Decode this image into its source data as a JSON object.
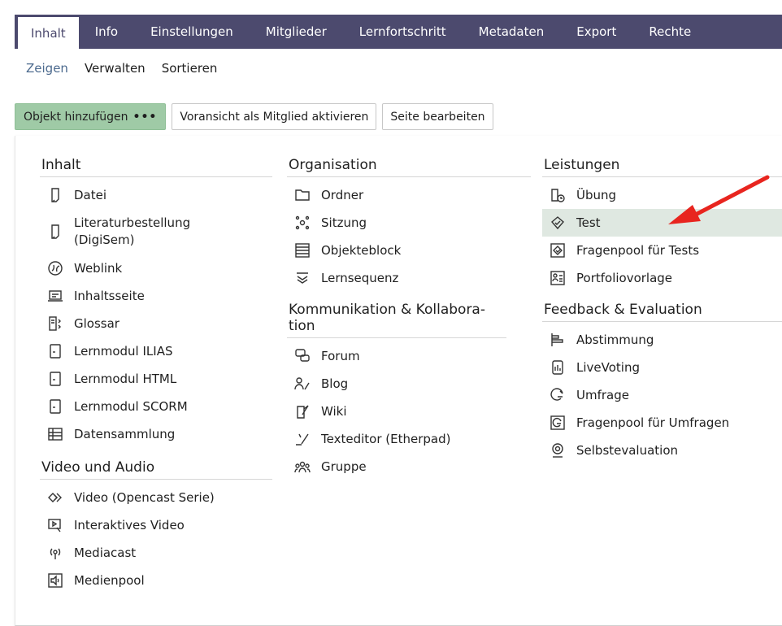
{
  "tabs": [
    {
      "label": "Inhalt"
    },
    {
      "label": "Info"
    },
    {
      "label": "Einstellungen"
    },
    {
      "label": "Mitglieder"
    },
    {
      "label": "Lernfortschritt"
    },
    {
      "label": "Metadaten"
    },
    {
      "label": "Export"
    },
    {
      "label": "Rechte"
    }
  ],
  "subtabs": [
    {
      "label": "Zeigen"
    },
    {
      "label": "Verwalten"
    },
    {
      "label": "Sortieren"
    }
  ],
  "toolbar": {
    "add_label": "Objekt hinzufügen",
    "add_dots": "•••",
    "preview_label": "Voransicht als Mitglied aktivieren",
    "edit_label": "Seite bearbeiten"
  },
  "menu": {
    "inhalt": {
      "title": "Inhalt",
      "items": [
        {
          "label": "Datei",
          "icon": "file-icon"
        },
        {
          "label": "Literaturbestellung (DigiSem)",
          "icon": "file-icon"
        },
        {
          "label": "Weblink",
          "icon": "weblink-icon"
        },
        {
          "label": "Inhaltsseite",
          "icon": "content-page-icon"
        },
        {
          "label": "Glossar",
          "icon": "glossary-icon"
        },
        {
          "label": "Lernmodul ILIAS",
          "icon": "learning-module-icon"
        },
        {
          "label": "Lernmodul HTML",
          "icon": "learning-module-icon"
        },
        {
          "label": "Lernmodul SCORM",
          "icon": "learning-module-icon"
        },
        {
          "label": "Datensammlung",
          "icon": "data-collection-icon"
        }
      ]
    },
    "video": {
      "title": "Video und Audio",
      "items": [
        {
          "label": "Video (Opencast Serie)",
          "icon": "video-icon"
        },
        {
          "label": "Interaktives Video",
          "icon": "interactive-video-icon"
        },
        {
          "label": "Mediacast",
          "icon": "mediacast-icon"
        },
        {
          "label": "Medienpool",
          "icon": "mediapool-icon"
        }
      ]
    },
    "organisation": {
      "title": "Organisation",
      "items": [
        {
          "label": "Ordner",
          "icon": "folder-icon"
        },
        {
          "label": "Sitzung",
          "icon": "session-icon"
        },
        {
          "label": "Objekteblock",
          "icon": "object-block-icon"
        },
        {
          "label": "Lernsequenz",
          "icon": "learning-sequence-icon"
        }
      ]
    },
    "kommunikation": {
      "title": "Kommunikation & Kollabora-tion",
      "items": [
        {
          "label": "Forum",
          "icon": "forum-icon"
        },
        {
          "label": "Blog",
          "icon": "blog-icon"
        },
        {
          "label": "Wiki",
          "icon": "wiki-icon"
        },
        {
          "label": "Texteditor (Etherpad)",
          "icon": "etherpad-icon"
        },
        {
          "label": "Gruppe",
          "icon": "group-icon"
        }
      ]
    },
    "leistungen": {
      "title": "Leistungen",
      "items": [
        {
          "label": "Übung",
          "icon": "exercise-icon"
        },
        {
          "label": "Test",
          "icon": "test-icon"
        },
        {
          "label": "Fragenpool für Tests",
          "icon": "question-pool-icon"
        },
        {
          "label": "Portfoliovorlage",
          "icon": "portfolio-template-icon"
        }
      ]
    },
    "feedback": {
      "title": "Feedback & Evaluation",
      "items": [
        {
          "label": "Abstimmung",
          "icon": "poll-icon"
        },
        {
          "label": "LiveVoting",
          "icon": "live-voting-icon"
        },
        {
          "label": "Umfrage",
          "icon": "survey-icon"
        },
        {
          "label": "Fragenpool für Umfragen",
          "icon": "survey-pool-icon"
        },
        {
          "label": "Selbstevaluation",
          "icon": "self-evaluation-icon"
        }
      ]
    }
  },
  "colors": {
    "tabbar": "#4c4a6e",
    "primary_button": "#9fcaa6",
    "highlight_row": "#dfe8e1",
    "arrow": "#e8251f"
  }
}
